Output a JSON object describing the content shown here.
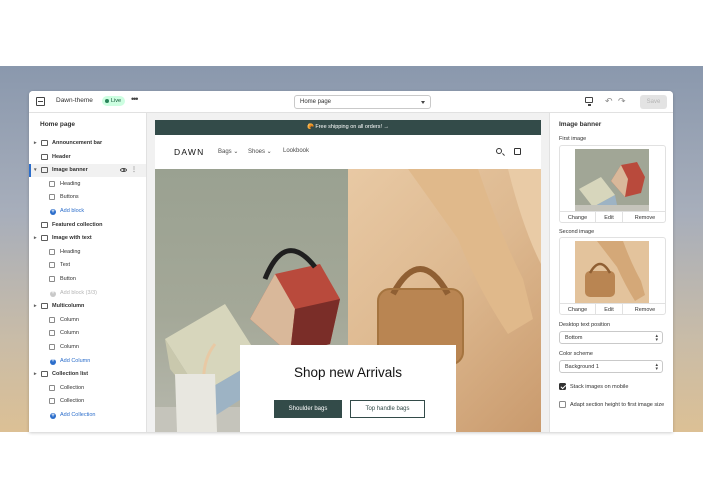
{
  "topbar": {
    "theme_name": "Dawn-theme",
    "status_badge": "Live",
    "page_selector": "Home page",
    "save_label": "Save"
  },
  "sidebar": {
    "title": "Home page",
    "items": [
      {
        "label": "Announcement bar",
        "type": "section",
        "icon": "announcement-icon",
        "expandable": true
      },
      {
        "label": "Header",
        "type": "section",
        "icon": "header-icon",
        "expandable": false
      },
      {
        "label": "Image banner",
        "type": "section",
        "icon": "image-banner-icon",
        "expandable": true,
        "active": true
      },
      {
        "label": "Heading",
        "type": "block",
        "icon": "block-icon"
      },
      {
        "label": "Buttons",
        "type": "block",
        "icon": "block-icon"
      },
      {
        "label": "Add block",
        "type": "add"
      },
      {
        "label": "Featured collection",
        "type": "section",
        "icon": "featured-collection-icon",
        "expandable": false
      },
      {
        "label": "Image with text",
        "type": "section",
        "icon": "image-with-text-icon",
        "expandable": true
      },
      {
        "label": "Heading",
        "type": "block",
        "icon": "block-icon"
      },
      {
        "label": "Text",
        "type": "block",
        "icon": "block-icon"
      },
      {
        "label": "Button",
        "type": "block",
        "icon": "block-icon"
      },
      {
        "label": "Add block (3/3)",
        "type": "add-disabled"
      },
      {
        "label": "Multicolumn",
        "type": "section",
        "icon": "multicolumn-icon",
        "expandable": true
      },
      {
        "label": "Column",
        "type": "block",
        "icon": "column-icon"
      },
      {
        "label": "Column",
        "type": "block",
        "icon": "column-icon"
      },
      {
        "label": "Column",
        "type": "block",
        "icon": "column-icon"
      },
      {
        "label": "Add Column",
        "type": "add"
      },
      {
        "label": "Collection list",
        "type": "section",
        "icon": "collection-list-icon",
        "expandable": true
      },
      {
        "label": "Collection",
        "type": "block",
        "icon": "block-icon"
      },
      {
        "label": "Collection",
        "type": "block",
        "icon": "block-icon"
      },
      {
        "label": "Add Collection",
        "type": "add"
      }
    ]
  },
  "preview": {
    "announcement": "🥐 Free shipping on all orders!  →",
    "logo": "DAWN",
    "nav": [
      {
        "label": "Bags ⌄"
      },
      {
        "label": "Shoes ⌄"
      },
      {
        "label": "Lookbook"
      }
    ],
    "banner": {
      "heading": "Shop new Arrivals",
      "primary_button": "Shoulder bags",
      "secondary_button": "Top handle bags"
    }
  },
  "settings": {
    "title": "Image banner",
    "first_image": {
      "label": "First image",
      "actions": [
        "Change",
        "Edit",
        "Remove"
      ]
    },
    "second_image": {
      "label": "Second image",
      "actions": [
        "Change",
        "Edit",
        "Remove"
      ]
    },
    "text_position": {
      "label": "Desktop text position",
      "value": "Bottom"
    },
    "color_scheme": {
      "label": "Color scheme",
      "value": "Background 1"
    },
    "stack_images": {
      "label": "Stack images on mobile",
      "checked": true
    },
    "adapt_height": {
      "label": "Adapt section height to first image size",
      "checked": false
    }
  },
  "colors": {
    "brand_dark": "#334b49",
    "accent_blue": "#2c6ecb",
    "live_green": "#29845a"
  }
}
